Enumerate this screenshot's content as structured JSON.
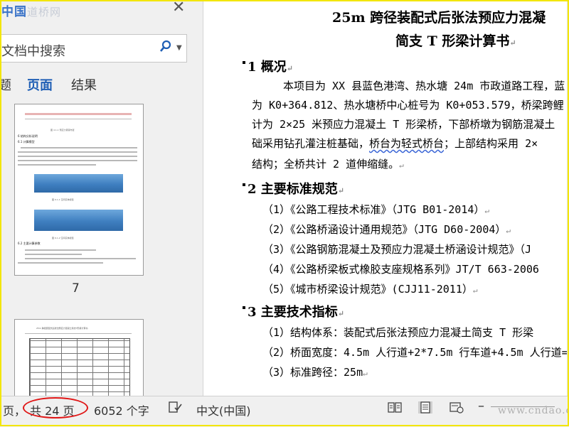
{
  "logo": {
    "main": "中国",
    "sub": "道桥网"
  },
  "nav": {
    "search_placeholder": "文档中搜索",
    "tabs": [
      "题",
      "页面",
      "结果"
    ],
    "active_tab": "页面",
    "page_label": "7",
    "thumb_fig1_caption": "图 4.1-1  预应力钢束布置",
    "thumb_section_61": "6 结构分析说明",
    "thumb_section_611": "6.1 计算模型",
    "thumb_fig2_caption": "图 6.1-1  空间实体模型",
    "thumb_fig3_caption": "图 6.1-2  空间实体模型",
    "thumb_section_62": "6.2 主要计算参数",
    "thumb_page8_title": "25m 跨径装配式后张法预应力混凝土简支T形梁计算书"
  },
  "doc": {
    "title_line1": "25m 跨径装配式后张法预应力混凝",
    "title_line2": "简支 T 形梁计算书",
    "sections": [
      {
        "heading": "1 概况",
        "lines": [
          "本项目为 XX 县蓝色港湾、热水塘 24m 市政道路工程，蓝",
          "为 K0+364.812、热水塘桥中心桩号为 K0+053.579，桥梁跨鲤",
          "计为 2×25 米预应力混凝土 T 形梁桥，下部桥墩为钢筋混凝土",
          "础采用钻孔灌注桩基础，桥台为轻式桥台；上部结构采用 2×",
          "结构；全桥共计 2 道伸缩缝。"
        ]
      },
      {
        "heading": "2 主要标准规范",
        "lines": [
          "（1）《公路工程技术标准》（JTG B01-2014）",
          "（2）《公路桥涵设计通用规范》（JTG D60-2004）",
          "（3）《公路钢筋混凝土及预应力混凝土桥涵设计规范》（J",
          "（4）《公路桥梁板式橡胶支座规格系列》JT/T 663-2006",
          "（5）《城市桥梁设计规范》(CJJ11-2011）"
        ]
      },
      {
        "heading": "3 主要技术指标",
        "lines": [
          "（1）结构体系：装配式后张法预应力混凝土简支 T 形梁",
          "（2）桥面宽度：4.5m 人行道+2*7.5m 行车道+4.5m 人行道=",
          "（3）标准跨径：25m"
        ]
      }
    ]
  },
  "status": {
    "page_prefix": "页，",
    "total_pages": "共 24 页",
    "word_count": "6052 个字",
    "language": "中文(中国)"
  },
  "watermark": "www.cndao.com"
}
